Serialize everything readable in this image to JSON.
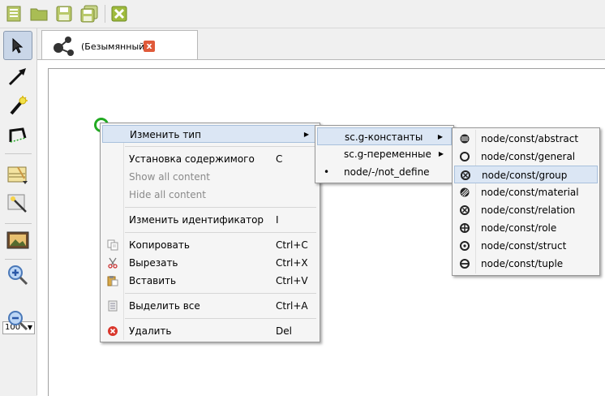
{
  "toolbar": {
    "items": [
      {
        "name": "new-file-icon"
      },
      {
        "name": "open-folder-icon"
      },
      {
        "name": "save-icon"
      },
      {
        "name": "save-all-icon"
      },
      {
        "name": "close-file-icon"
      }
    ]
  },
  "tools": {
    "zoom_value": "100'",
    "zoom_arrow": "▼"
  },
  "tab": {
    "title": "(Безымянный)",
    "close": "x"
  },
  "context_menu": {
    "change_type": "Изменить тип",
    "set_content": "Установка содержимого",
    "set_content_sc": "C",
    "show_all": "Show all content",
    "hide_all": "Hide all content",
    "change_id": "Изменить идентификатор",
    "change_id_sc": "I",
    "copy": "Копировать",
    "copy_sc": "Ctrl+C",
    "cut": "Вырезать",
    "cut_sc": "Ctrl+X",
    "paste": "Вставить",
    "paste_sc": "Ctrl+V",
    "select_all": "Выделить все",
    "select_all_sc": "Ctrl+A",
    "delete": "Удалить",
    "delete_sc": "Del",
    "arrow": "▶"
  },
  "type_menu": {
    "constants": "sc.g-константы",
    "variables": "sc.g-переменные",
    "not_define": "node/-/not_define",
    "bullet": "•",
    "arrow": "▶"
  },
  "const_menu": {
    "items": [
      "node/const/abstract",
      "node/const/general",
      "node/const/group",
      "node/const/material",
      "node/const/relation",
      "node/const/role",
      "node/const/struct",
      "node/const/tuple"
    ]
  },
  "colors": {
    "highlight": "#dbe6f4",
    "node": "#22aa22",
    "delete": "#d9362b"
  }
}
